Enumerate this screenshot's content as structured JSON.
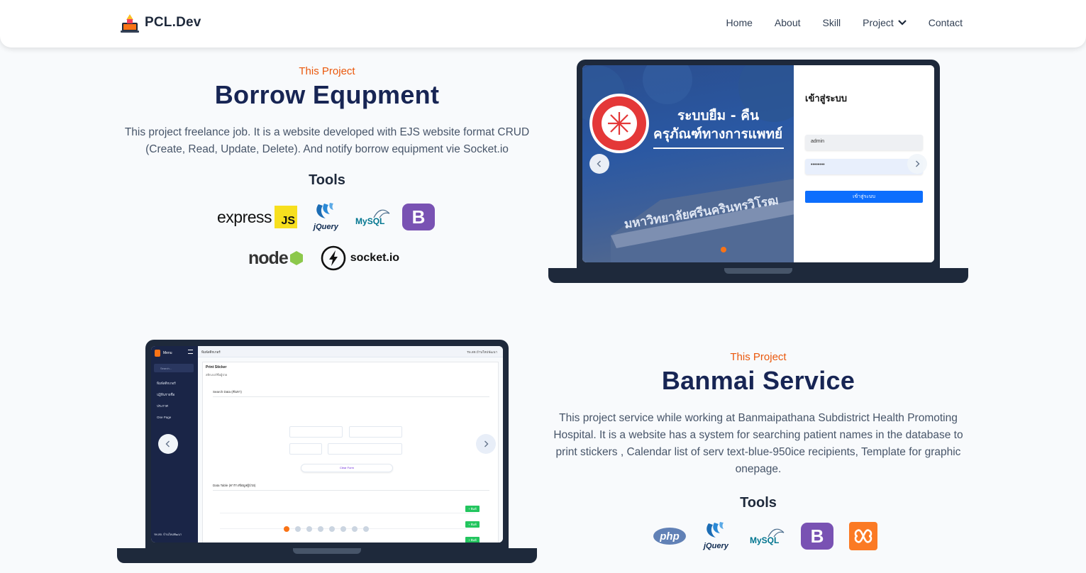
{
  "nav": {
    "brand": "PCL.Dev",
    "items": [
      {
        "label": "Home"
      },
      {
        "label": "About"
      },
      {
        "label": "Skill"
      },
      {
        "label": "Project"
      },
      {
        "label": "Contact"
      }
    ]
  },
  "projects": [
    {
      "eyebrow": "This Project",
      "title": "Borrow Equpment",
      "description": "This project freelance job. It is a website developed with EJS website format CRUD (Create, Read, Update, Delete). And notify borrow equipment vie Socket.io",
      "tools_title": "Tools",
      "tools": [
        "express",
        "JS",
        "jQuery",
        "MySQL",
        "B",
        "node",
        "socket.io"
      ],
      "screenshot": {
        "banner_line1": "ระบบยืม - คืน",
        "banner_line2": "ครุภัณฑ์ทางการแพทย์",
        "building_text": "มหาวิทยาลัยศรีนครินทรวิโรฒ",
        "login_title": "เข้าสู่ระบบ",
        "username_value": "admin",
        "password_value": "••••••••",
        "login_button": "เข้าสู่ระบบ"
      }
    },
    {
      "eyebrow": "This Project",
      "title": "Banmai Service",
      "description": "This project service while working at Banmaipathana Subdistrict Health Promoting Hospital. It is a website has a system for searching patient names in the database to print stickers , Calendar list of serv text-blue-950ice recipients, Template for graphic onepage.",
      "tools_title": "Tools",
      "tools": [
        "php",
        "jQuery",
        "MySQL",
        "B",
        "XAMPP"
      ],
      "screenshot": {
        "sidebar_title": "Menu",
        "search_placeholder": "Search...",
        "sidebar_items": [
          "พิมพ์สติกเกอร์",
          "ปฏิทินรายชื่อ",
          "ประกาศ",
          "One Page"
        ],
        "breadcrumb": "พิมพ์สติกเกอร์",
        "topbar_right": "รพ.สต.บ้านใหม่พัฒนา",
        "card_title": "Print Sticker",
        "card_subtitle": "สติกเกอร์ชื่อผู้ป่วย",
        "search_section": "Search Data (ค้นหา)",
        "clear_button": "Clear Form",
        "data_section": "Data Table (ตารางข้อมูลผู้ป่วย)",
        "footer_text": "รพ.สต. บ้านใหม่พัฒนา",
        "print_label": "+ พิมพ์"
      }
    }
  ]
}
